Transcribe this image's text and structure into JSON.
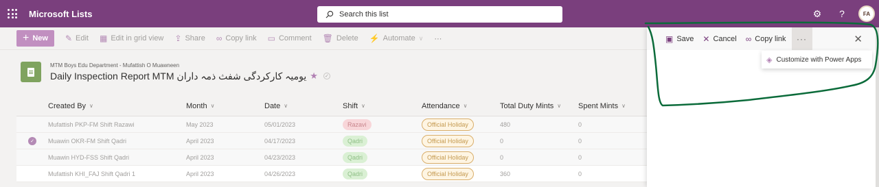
{
  "suite": {
    "app_name": "Microsoft Lists",
    "search_placeholder": "Search this list",
    "avatar_initials": "FA"
  },
  "commands": {
    "new": "New",
    "edit": "Edit",
    "grid": "Edit in grid view",
    "share": "Share",
    "copy_link": "Copy link",
    "comment": "Comment",
    "delete": "Delete",
    "automate": "Automate",
    "more": "⋯"
  },
  "list": {
    "site_name": "MTM Boys Edu Department - Mufattish O Muawneen",
    "title": "Daily Inspection Report MTM يومیہ کارکردگی شفث ذمہ داران"
  },
  "table": {
    "columns": [
      "Created By",
      "Month",
      "Date",
      "Shift",
      "Attendance",
      "Total Duty Mints",
      "Spent Mints"
    ],
    "rows": [
      {
        "created_by": "Mufattish PKP-FM Shift Razawi",
        "month": "May 2023",
        "date": "05/01/2023",
        "shift": "Razavi",
        "attendance": "Official Holiday",
        "total": "480",
        "spent": "0",
        "selected": false
      },
      {
        "created_by": "Muawin OKR-FM Shift Qadri",
        "month": "April 2023",
        "date": "04/17/2023",
        "shift": "Qadri",
        "attendance": "Official Holiday",
        "total": "0",
        "spent": "0",
        "selected": true
      },
      {
        "created_by": "Muawin HYD-FSS Shift Qadri",
        "month": "April 2023",
        "date": "04/23/2023",
        "shift": "Qadri",
        "attendance": "Official Holiday",
        "total": "0",
        "spent": "0",
        "selected": false
      },
      {
        "created_by": "Mufattish KHI_FAJ Shift Qadri 1",
        "month": "April 2023",
        "date": "04/26/2023",
        "shift": "Qadri",
        "attendance": "Official Holiday",
        "total": "360",
        "spent": "0",
        "selected": false
      }
    ]
  },
  "panel": {
    "save": "Save",
    "cancel": "Cancel",
    "copy_link": "Copy link",
    "more": "···",
    "dropdown_item": "Customize with Power Apps"
  },
  "colors": {
    "suite_bar": "#7a3f7d",
    "new_button": "#c18fc0",
    "annotation_stroke": "#0b6b3a"
  }
}
